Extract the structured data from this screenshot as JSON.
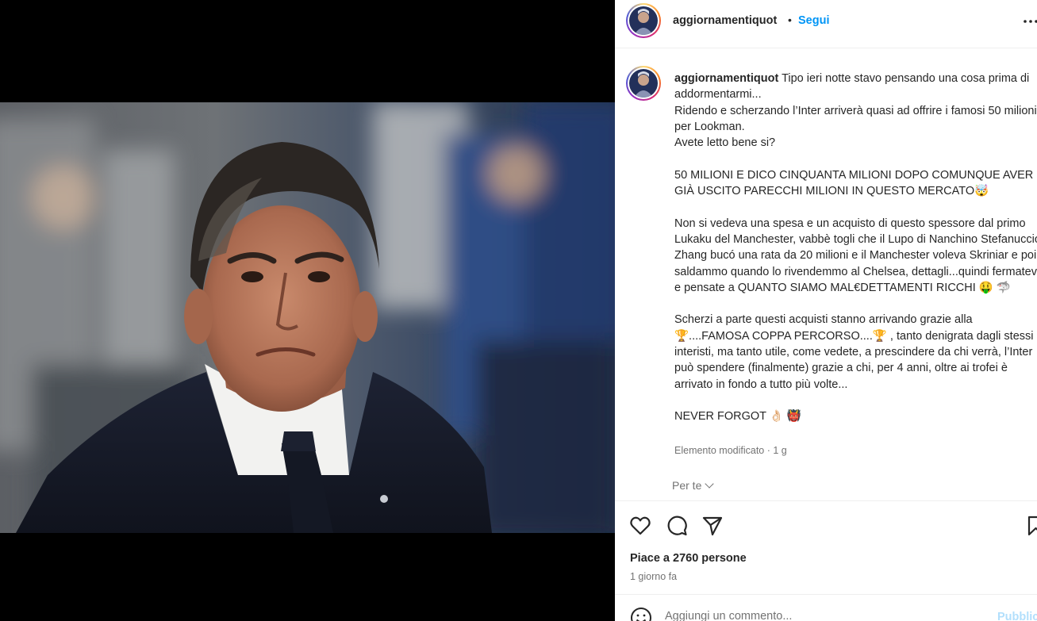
{
  "post": {
    "username": "aggiornamentiquot",
    "follow_label": "Segui",
    "separator": "•",
    "more_options": "more-options-icon"
  },
  "caption": {
    "username": "aggiornamentiquot",
    "text": " Tipo ieri notte stavo pensando una cosa prima di addormentarmi...\nRidendo e scherzando l’Inter arriverà quasi ad offrire i famosi 50 milioni per Lookman.\nAvete letto bene si?\n\n50 MILIONI E DICO CINQUANTA MILIONI DOPO COMUNQUE AVER GIÀ USCITO PARECCHI MILIONI IN QUESTO MERCATO🤯\n\nNon si vedeva una spesa e un acquisto di questo spessore dal primo Lukaku del Manchester, vabbè togli che il Lupo di Nanchino Stefanuccio Zhang bucó una rata da 20 milioni e il Manchester voleva Skriniar e poi saldammo quando lo rivendemmo al Chelsea, dettagli...quindi fermatevi e pensate a QUANTO SIAMO MAL€DETTAMENTI RICCHI 🤑 🦈\n\nScherzi a parte questi acquisti stanno arrivando grazie alla 🏆....FAMOSA COPPA PERCORSO....🏆 , tanto denigrata dagli stessi interisti, ma tanto utile, come vedete, a prescindere da chi verrà, l’Inter può spendere (finalmente) grazie a chi, per 4 anni, oltre ai trofei è arrivato in fondo a tutto più volte...\n\nNEVER FORGOT 👌🏻 👹",
    "meta": "Elemento modificato · 1 g",
    "translation_label": "Per te"
  },
  "actions": {
    "likes": "Piace a 2760 persone",
    "time": "1 giorno fa"
  },
  "comment": {
    "placeholder": "Aggiungi un commento...",
    "publish_label": "Pubblica"
  },
  "colors": {
    "accent": "#0095f6",
    "publish_disabled": "#b2dffc",
    "secondary_text": "#737373"
  }
}
